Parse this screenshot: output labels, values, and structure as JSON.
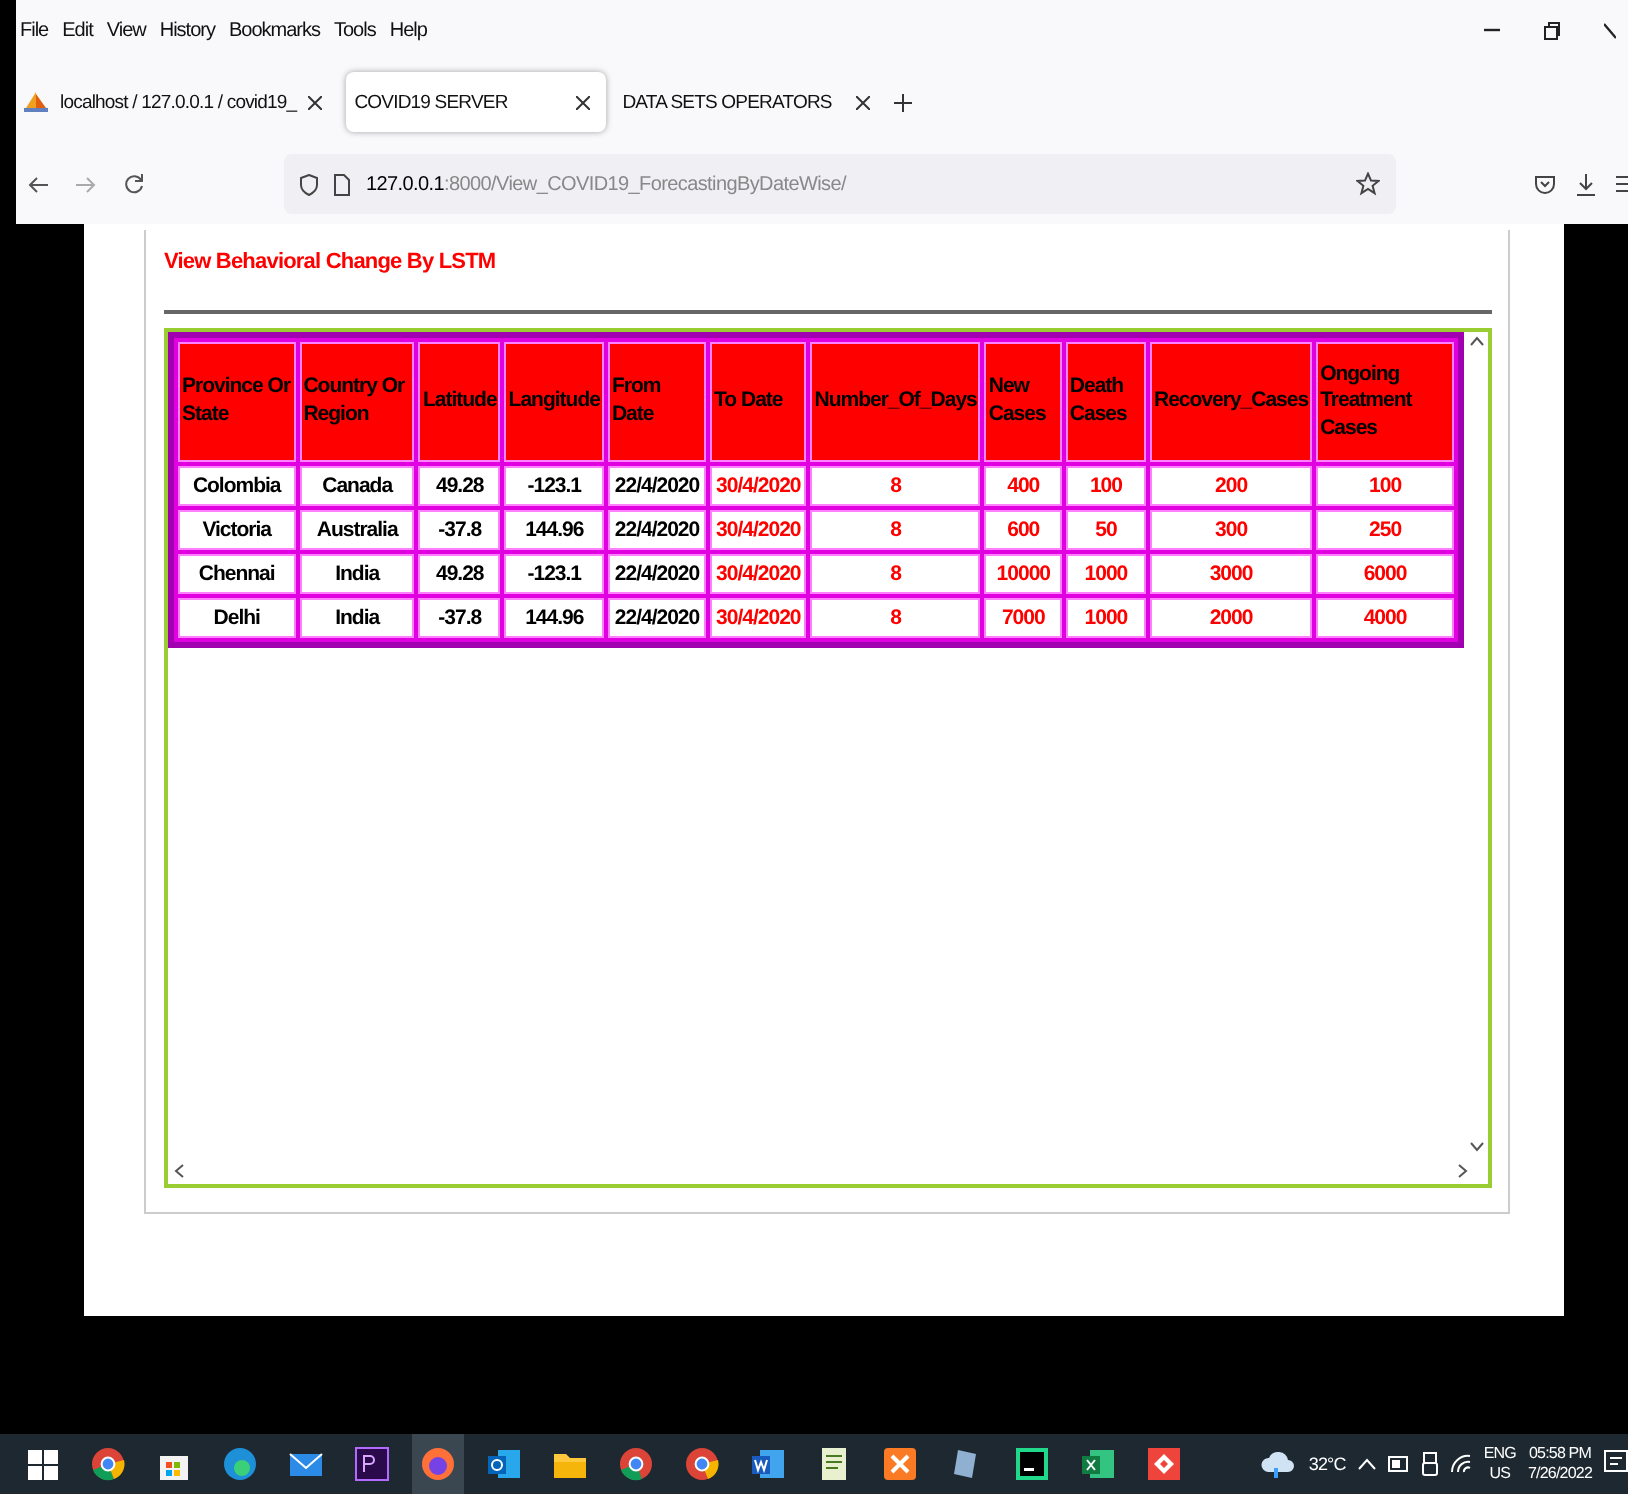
{
  "menu": [
    "File",
    "Edit",
    "View",
    "History",
    "Bookmarks",
    "Tools",
    "Help"
  ],
  "tabs": [
    {
      "label": "localhost / 127.0.0.1 / covid19_",
      "selected": false,
      "kind": "db"
    },
    {
      "label": "COVID19 SERVER",
      "selected": true,
      "kind": "plain"
    },
    {
      "label": "DATA SETS OPERATORS",
      "selected": false,
      "kind": "plain"
    }
  ],
  "address": {
    "host": "127.0.0.1",
    "path": ":8000/View_COVID19_ForecastingByDateWise/"
  },
  "page": {
    "title": "View Behavioral Change By LSTM"
  },
  "table": {
    "columns": [
      {
        "label": "Province Or State",
        "color": "#000000"
      },
      {
        "label": "Country Or Region",
        "color": "#000000"
      },
      {
        "label": "Latitude",
        "color": "#000000"
      },
      {
        "label": "Langitude",
        "color": "#000000"
      },
      {
        "label": "From Date",
        "color": "#000000"
      },
      {
        "label": "To Date",
        "color": "#ff0000"
      },
      {
        "label": "Number_Of_Days",
        "color": "#ff0000"
      },
      {
        "label": "New Cases",
        "color": "#ff0000"
      },
      {
        "label": "Death Cases",
        "color": "#ff0000"
      },
      {
        "label": "Recovery_Cases",
        "color": "#ff0000"
      },
      {
        "label": "Ongoing Treatment Cases",
        "color": "#ff0000"
      }
    ],
    "rows": [
      [
        "Colombia",
        "Canada",
        "49.28",
        "-123.1",
        "22/4/2020",
        "30/4/2020",
        "8",
        "400",
        "100",
        "200",
        "100"
      ],
      [
        "Victoria",
        "Australia",
        "-37.8",
        "144.96",
        "22/4/2020",
        "30/4/2020",
        "8",
        "600",
        "50",
        "300",
        "250"
      ],
      [
        "Chennai",
        "India",
        "49.28",
        "-123.1",
        "22/4/2020",
        "30/4/2020",
        "8",
        "10000",
        "1000",
        "3000",
        "6000"
      ],
      [
        "Delhi",
        "India",
        "-37.8",
        "144.96",
        "22/4/2020",
        "30/4/2020",
        "8",
        "7000",
        "1000",
        "2000",
        "4000"
      ]
    ]
  },
  "taskbar": {
    "weather": "32°C",
    "language": "ENG",
    "region": "US",
    "time": "05:58 PM",
    "date": "7/26/2022"
  }
}
